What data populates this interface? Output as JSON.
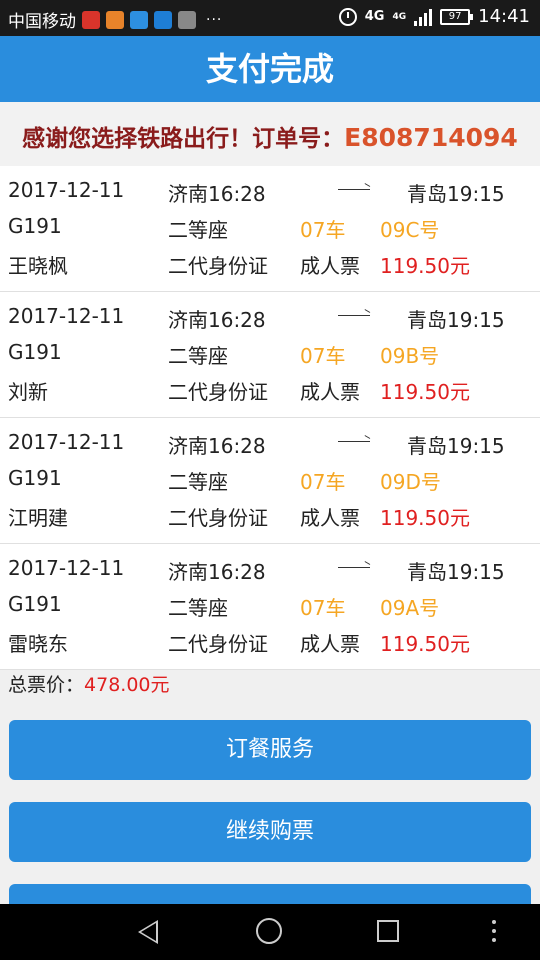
{
  "status_bar": {
    "carrier": "中国移动",
    "dots": "···",
    "network": "4G",
    "network_small": "4G",
    "battery": "97",
    "time": "14:41",
    "icons": [
      "app-icon-red",
      "app-icon-orange",
      "app-icon-blue",
      "app-icon-alipay",
      "app-icon-avatar"
    ]
  },
  "header": {
    "title": "支付完成"
  },
  "thanks": {
    "text": "感谢您选择铁路出行！订单号：",
    "order_no": "E808714094"
  },
  "tickets": [
    {
      "date": "2017-12-11",
      "from": "济南16:28",
      "to": "青岛19:15",
      "train": "G191",
      "seat_class": "二等座",
      "car": "07车",
      "seat": "09C号",
      "name": "王晓枫",
      "id_type": "二代身份证",
      "ticket_type": "成人票",
      "price": "119.50元"
    },
    {
      "date": "2017-12-11",
      "from": "济南16:28",
      "to": "青岛19:15",
      "train": "G191",
      "seat_class": "二等座",
      "car": "07车",
      "seat": "09B号",
      "name": "刘新",
      "id_type": "二代身份证",
      "ticket_type": "成人票",
      "price": "119.50元"
    },
    {
      "date": "2017-12-11",
      "from": "济南16:28",
      "to": "青岛19:15",
      "train": "G191",
      "seat_class": "二等座",
      "car": "07车",
      "seat": "09D号",
      "name": "江明建",
      "id_type": "二代身份证",
      "ticket_type": "成人票",
      "price": "119.50元"
    },
    {
      "date": "2017-12-11",
      "from": "济南16:28",
      "to": "青岛19:15",
      "train": "G191",
      "seat_class": "二等座",
      "car": "07车",
      "seat": "09A号",
      "name": "雷晓东",
      "id_type": "二代身份证",
      "ticket_type": "成人票",
      "price": "119.50元"
    }
  ],
  "total": {
    "label": "总票价：",
    "value": "478.00元"
  },
  "buttons": {
    "meal": "订餐服务",
    "continue": "继续购票"
  },
  "colors": {
    "primary": "#2a8ddd",
    "price": "#e02020",
    "seat": "#f5a623",
    "order_no": "#d9532b"
  }
}
